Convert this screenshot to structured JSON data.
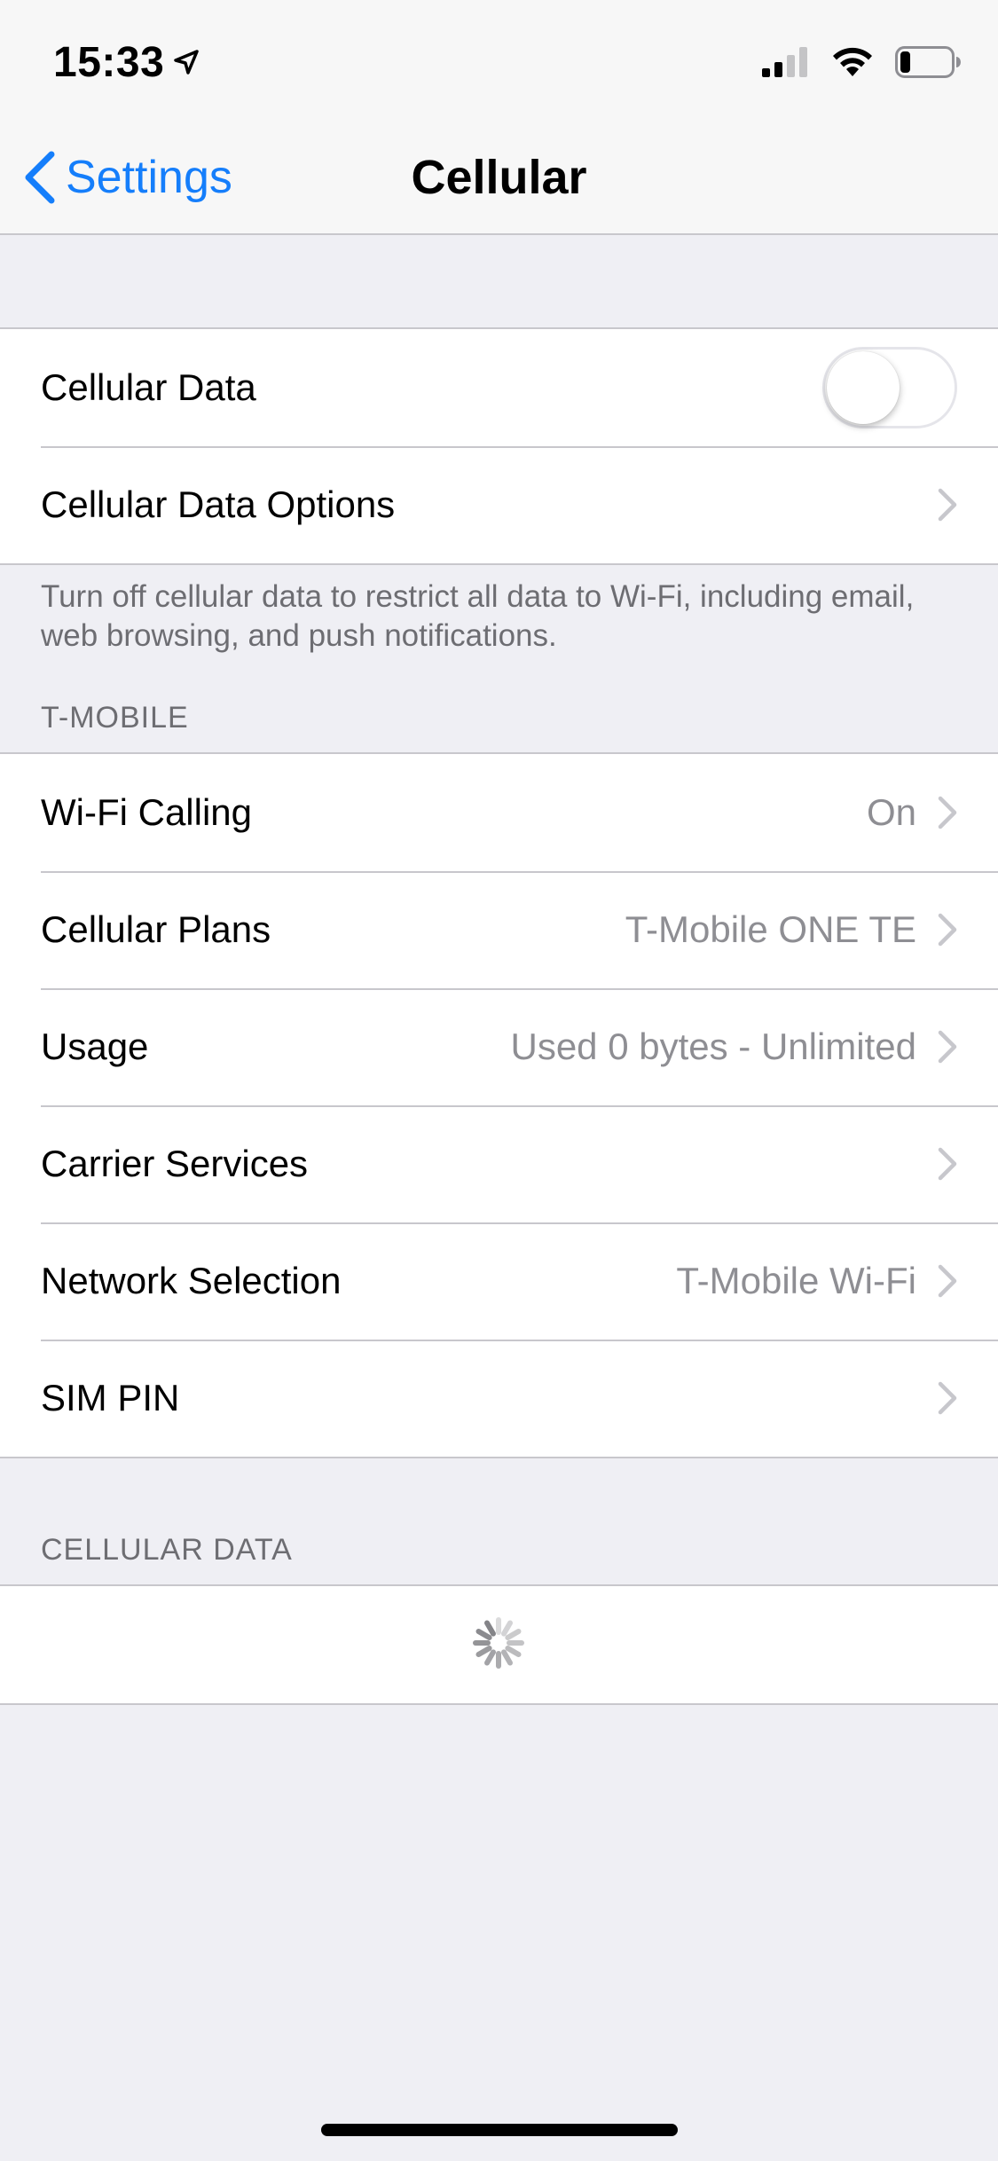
{
  "status_bar": {
    "time": "15:33",
    "icons": [
      "location-arrow-icon",
      "cellular-signal-icon",
      "wifi-icon",
      "battery-icon"
    ],
    "battery_level": 0.2
  },
  "nav": {
    "back_label": "Settings",
    "title": "Cellular"
  },
  "group_top": {
    "rows": [
      {
        "label": "Cellular Data",
        "toggle_on": false
      },
      {
        "label": "Cellular Data Options",
        "value": ""
      }
    ],
    "footer": "Turn off cellular data to restrict all data to Wi-Fi, including email, web browsing, and push notifications."
  },
  "group_carrier": {
    "header": "T-MOBILE",
    "rows": [
      {
        "label": "Wi-Fi Calling",
        "value": "On"
      },
      {
        "label": "Cellular Plans",
        "value": "T-Mobile ONE TE"
      },
      {
        "label": "Usage",
        "value": "Used 0 bytes - Unlimited"
      },
      {
        "label": "Carrier Services",
        "value": ""
      },
      {
        "label": "Network Selection",
        "value": "T-Mobile Wi-Fi"
      },
      {
        "label": "SIM PIN",
        "value": ""
      }
    ]
  },
  "group_data": {
    "header": "CELLULAR DATA",
    "loading_icon": "spinner-icon"
  },
  "colors": {
    "accent": "#157efb",
    "background": "#efeff4",
    "separator": "#c8c7cc",
    "secondary_text": "#8e8e93"
  }
}
